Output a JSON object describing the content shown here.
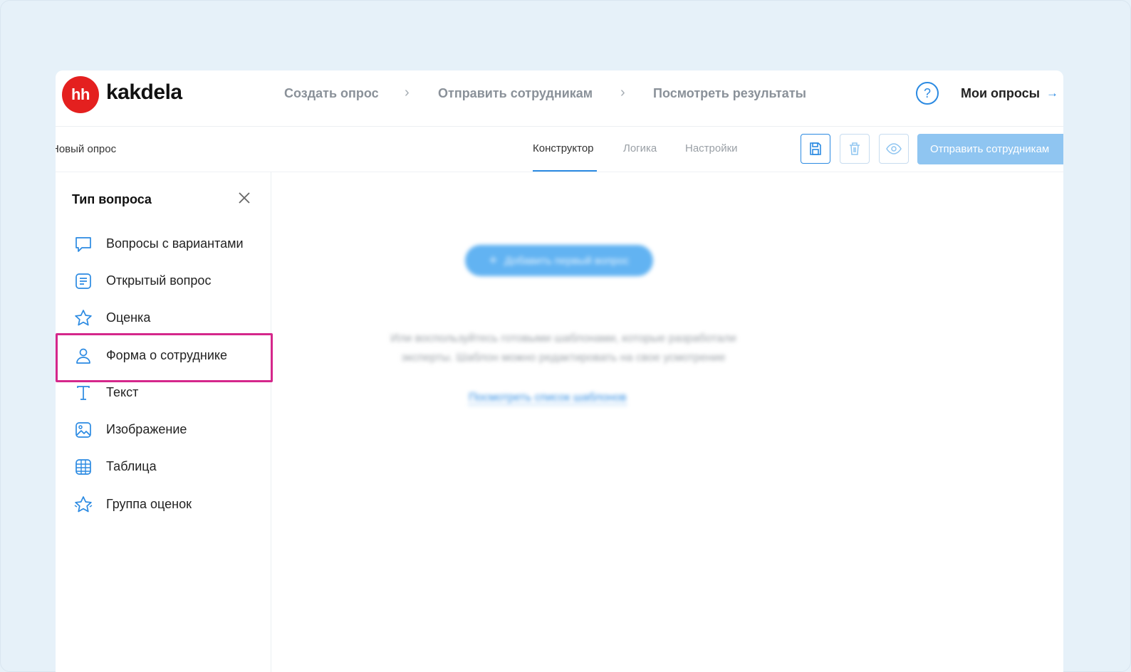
{
  "header": {
    "logo_mark": "hh",
    "logo_text": "kakdela",
    "steps": [
      "Создать опрос",
      "Отправить сотрудникам",
      "Посмотреть результаты"
    ],
    "help": "?",
    "my_surveys": "Мои опросы"
  },
  "toolbar": {
    "survey_name": "Новый опрос",
    "tabs": [
      "Конструктор",
      "Логика",
      "Настройки"
    ],
    "active_tab": "Конструктор",
    "send_label": "Отправить сотрудникам"
  },
  "sidebar": {
    "title": "Тип вопроса",
    "items": [
      {
        "label": "Вопросы с вариантами",
        "icon": "chat-bubble-icon"
      },
      {
        "label": "Открытый вопрос",
        "icon": "document-lines-icon"
      },
      {
        "label": "Оценка",
        "icon": "star-icon"
      },
      {
        "label": "Форма о сотруднике",
        "icon": "person-icon"
      },
      {
        "label": "Текст",
        "icon": "text-t-icon"
      },
      {
        "label": "Изображение",
        "icon": "image-icon"
      },
      {
        "label": "Таблица",
        "icon": "table-icon"
      },
      {
        "label": "Группа оценок",
        "icon": "stars-group-icon"
      }
    ],
    "highlighted_item": "Форма о сотруднике"
  },
  "main": {
    "add_question": "Добавить первый вопрос",
    "hint_line1": "Или воспользуйтесь готовыми шаблонами, которые разработали",
    "hint_line2": "эксперты. Шаблон можно редактировать на свое усмотрение",
    "templates_link": "Посмотреть список шаблонов"
  },
  "colors": {
    "accent": "#2b8ae2",
    "brand": "#e4201f",
    "highlight": "#d5278b"
  }
}
